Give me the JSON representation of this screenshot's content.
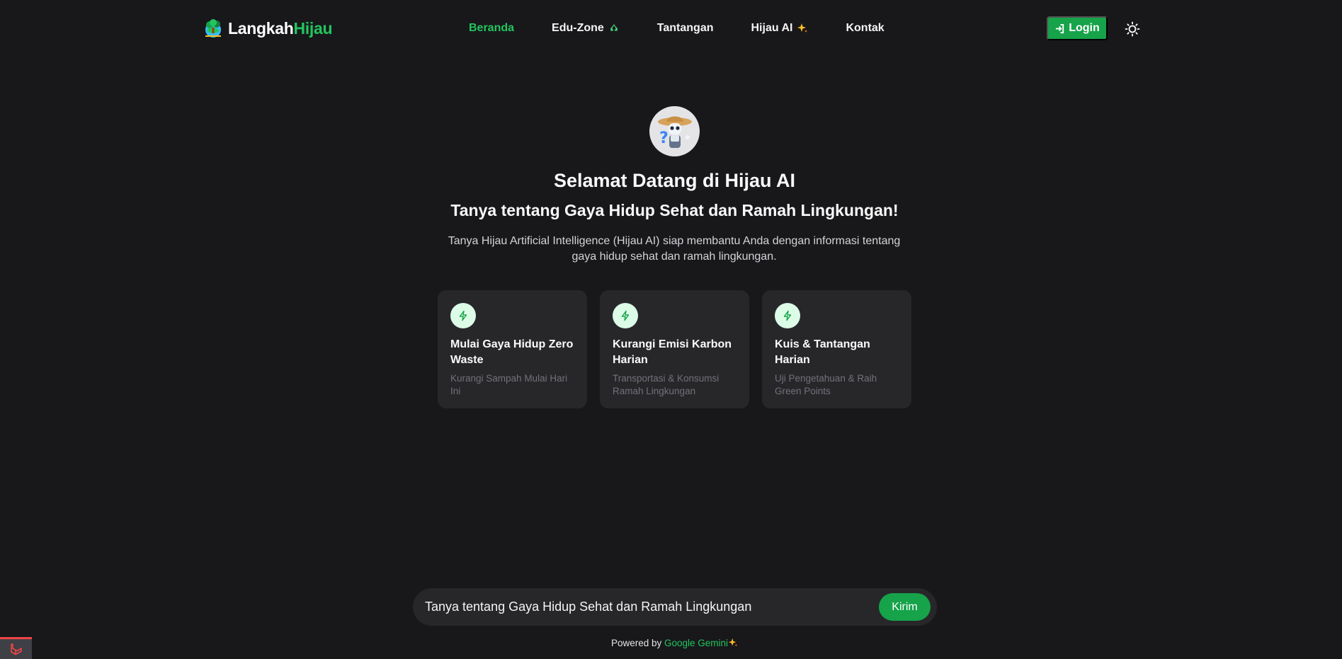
{
  "brand": {
    "name_part1": "Langkah",
    "name_part2": "Hijau",
    "logo_icon": "globe-tree-icon",
    "accent_color": "#22c55e"
  },
  "nav": {
    "items": [
      {
        "label": "Beranda",
        "active": true
      },
      {
        "label": "Edu-Zone",
        "icon": "recycle-icon"
      },
      {
        "label": "Tantangan"
      },
      {
        "label": "Hijau AI",
        "icon": "sparkles-icon"
      },
      {
        "label": "Kontak"
      }
    ],
    "login_label": "Login",
    "login_icon": "sign-in-icon",
    "theme_toggle_icon": "sun-icon"
  },
  "hero": {
    "avatar_icon": "robot-farmer-avatar",
    "title": "Selamat Datang di Hijau AI",
    "subtitle": "Tanya tentang Gaya Hidup Sehat dan Ramah Lingkungan!",
    "description": "Tanya Hijau Artificial Intelligence (Hijau AI) siap membantu Anda dengan informasi tentang gaya hidup sehat dan ramah lingkungan."
  },
  "cards": [
    {
      "icon": "bolt-icon",
      "title": "Mulai Gaya Hidup Zero Waste",
      "subtitle": "Kurangi Sampah Mulai Hari Ini"
    },
    {
      "icon": "bolt-icon",
      "title": "Kurangi Emisi Karbon Harian",
      "subtitle": "Transportasi & Konsumsi Ramah Lingkungan"
    },
    {
      "icon": "bolt-icon",
      "title": "Kuis & Tantangan Harian",
      "subtitle": "Uji Pengetahuan & Raih Green Points"
    }
  ],
  "chat": {
    "placeholder": "Tanya tentang Gaya Hidup Sehat dan Ramah Lingkungan",
    "send_label": "Kirim"
  },
  "footer": {
    "powered_prefix": "Powered by",
    "powered_brand": "Google Gemini",
    "powered_icon": "sparkles-icon"
  },
  "dev_badge_icon": "laravel-icon"
}
